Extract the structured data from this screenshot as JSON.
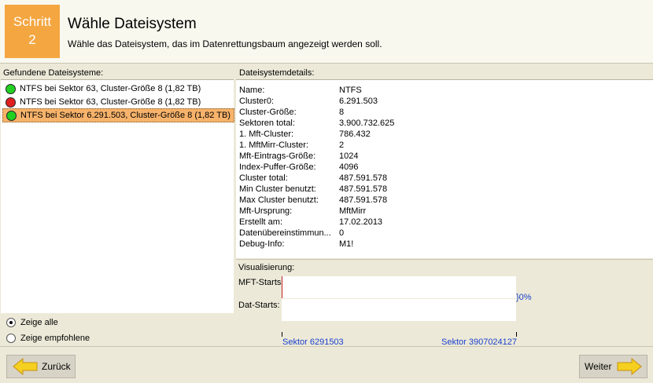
{
  "header": {
    "step_word": "Schritt",
    "step_number": "2",
    "title": "Wähle Dateisystem",
    "subtitle": "Wähle das Dateisystem, das im Datenrettungsbaum angezeigt werden soll."
  },
  "left": {
    "label": "Gefundene Dateisysteme:",
    "items": [
      {
        "text": "NTFS bei Sektor 63, Cluster-Größe 8 (1,82 TB)",
        "status": "green"
      },
      {
        "text": "NTFS bei Sektor 63, Cluster-Größe 8 (1,82 TB)",
        "status": "red"
      },
      {
        "text": "NTFS bei Sektor 6.291.503, Cluster-Größe 8 (1,82 TB)",
        "status": "green",
        "selected": true
      }
    ],
    "radio_all": "Zeige alle",
    "radio_recommended": "Zeige empfohlene",
    "radio_selected": "all"
  },
  "details": {
    "label": "Dateisystemdetails:",
    "rows": [
      {
        "key": "Name:",
        "value": "NTFS"
      },
      {
        "key": "Cluster0:",
        "value": "6.291.503"
      },
      {
        "key": "Cluster-Größe:",
        "value": "8"
      },
      {
        "key": "Sektoren total:",
        "value": "3.900.732.625"
      },
      {
        "key": "1. Mft-Cluster:",
        "value": "786.432"
      },
      {
        "key": "1. MftMirr-Cluster:",
        "value": "2"
      },
      {
        "key": "Mft-Eintrags-Größe:",
        "value": "1024"
      },
      {
        "key": "Index-Puffer-Größe:",
        "value": "4096"
      },
      {
        "key": "Cluster total:",
        "value": "487.591.578"
      },
      {
        "key": "Min Cluster benutzt:",
        "value": "487.591.578"
      },
      {
        "key": "Max Cluster benutzt:",
        "value": "487.591.578"
      },
      {
        "key": "Mft-Ursprung:",
        "value": "MftMirr"
      },
      {
        "key": "Erstellt am:",
        "value": "17.02.2013"
      },
      {
        "key": "Datenübereinstimmun...",
        "value": "0"
      },
      {
        "key": "Debug-Info:",
        "value": "M1!"
      }
    ]
  },
  "visual": {
    "label": "Visualisierung:",
    "mft_label": "MFT-Starts",
    "dat_label": "Dat-Starts:",
    "percent": "}0%",
    "sector_start": "Sektor 6291503",
    "sector_end": "Sektor 3907024127"
  },
  "footer": {
    "back_label": "Zurück",
    "next_label": "Weiter"
  },
  "colors": {
    "accent": "#f4a640",
    "selection": "#f7b36b",
    "link": "#1a3fcc"
  }
}
